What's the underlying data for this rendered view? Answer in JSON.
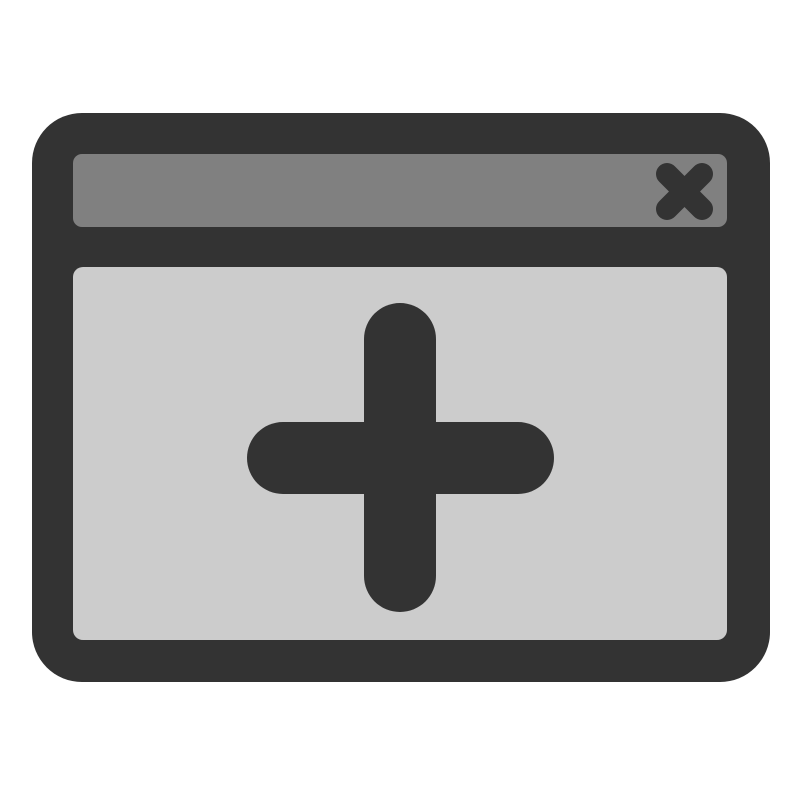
{
  "icon": {
    "name": "new-window-icon",
    "parts": {
      "close_glyph": "close-icon",
      "add_glyph": "plus-icon"
    }
  },
  "colors": {
    "background": "#ffffff",
    "outline": "#333333",
    "title_bar": "#808080",
    "window_body": "#cccccc"
  }
}
